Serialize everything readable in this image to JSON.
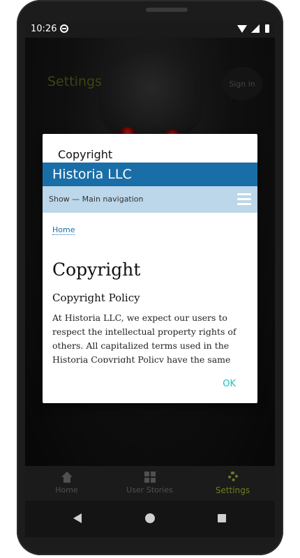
{
  "status_bar": {
    "time": "10:26"
  },
  "app": {
    "title": "Settings",
    "sign_in_label": "Sign in"
  },
  "dialog": {
    "title": "Copyright",
    "web": {
      "header": "Historia LLC",
      "nav_label": "Show — Main navigation",
      "breadcrumb_home": "Home",
      "heading": "Copyright",
      "subheading": "Copyright Policy",
      "paragraph": "At Historia LLC, we expect our users to respect the intellectual property rights of others. All capitalized terms used in the Historia Copyright Policy have the same"
    },
    "ok_label": "OK"
  },
  "bottom_nav": {
    "items": [
      {
        "label": "Home",
        "icon": "home-icon"
      },
      {
        "label": "User Stories",
        "icon": "grid-icon"
      },
      {
        "label": "Settings",
        "icon": "gear-icon",
        "active": true
      }
    ]
  },
  "colors": {
    "accent_olive": "#6d7d21",
    "web_header_blue": "#1a6ea8",
    "web_nav_light_blue": "#bcd6ea",
    "ok_teal": "#20c0c0"
  }
}
